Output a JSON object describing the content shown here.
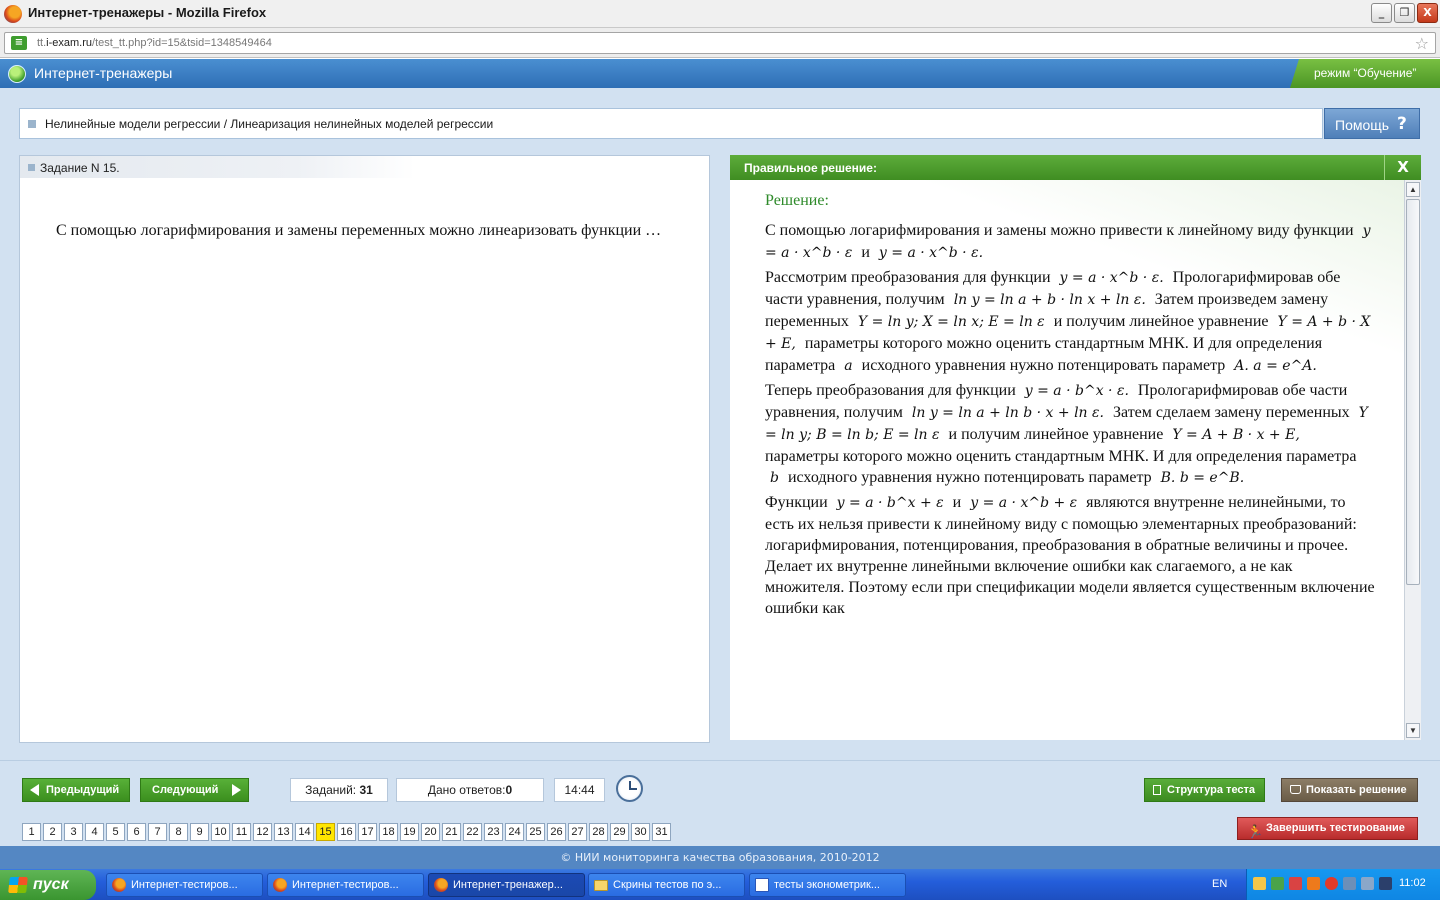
{
  "window": {
    "title": "Интернет-тренажеры - Mozilla Firefox",
    "url_prefix": "tt.",
    "url_host": "i-exam.ru",
    "url_path": "/test_tt.php?id=15&tsid=1348549464",
    "controls": {
      "minimize": "_",
      "maximize": "❐",
      "close": "X"
    }
  },
  "app": {
    "title": "Интернет-тренажеры",
    "mode": "режим “Обучение”"
  },
  "breadcrumb": {
    "text": "Нелинейные модели регрессии / Линеаризация нелинейных моделей регрессии"
  },
  "help": {
    "label": "Помощь",
    "icon": "?"
  },
  "task": {
    "header": "Задание N 15.",
    "question": "С помощью логарифмирования и замены переменных можно линеаризовать функции …"
  },
  "solution": {
    "header": "Правильное решение:",
    "close": "X",
    "heading": "Решение:",
    "text": {
      "p1": "С помощью логарифмирования и замены можно привести к линейному виду функции",
      "f1": "y = a · x^b · ε",
      "and": "и",
      "f2": "y = a · x^b · ε.",
      "p2a": "Рассмотрим преобразования для функции",
      "f3": "y = a · x^b · ε.",
      "p2b": "Прологарифмировав обе части уравнения, получим",
      "f4": "ln y = ln a + b · ln x + ln ε.",
      "p2c": "Затем произведем замену переменных",
      "f5": "Y = ln y; X = ln x; E = ln ε",
      "p2d": "и получим линейное уравнение",
      "f6": "Y = A + b · X + E,",
      "p2e": "параметры которого можно оценить стандартным МНК. И для определения параметра",
      "f7": "a",
      "p2f": "исходного уравнения нужно потенцировать параметр",
      "f8": "A.  a = e^A.",
      "p3a": "Теперь преобразования для функции",
      "f9": "y = a · b^x · ε.",
      "p3b": "Прологарифмировав обе части уравнения, получим",
      "f10": "ln y = ln a + ln b · x + ln ε.",
      "p3c": "Затем сделаем замену переменных",
      "f11": "Y = ln y; B = ln b; E = ln ε",
      "p3d": "и получим линейное уравнение",
      "f12": "Y = A + B · x + E,",
      "p3e": "параметры которого можно оценить стандартным МНК. И для определения параметра",
      "f13": "b",
      "p3f": "исходного уравнения нужно потенцировать параметр",
      "f14": "B.  b = e^B.",
      "p4a": "Функции",
      "f15": "y = a · b^x + ε",
      "f16": "y = a · x^b + ε",
      "p4b": "являются внутренне нелинейными, то есть их нельзя привести к линейному виду с помощью элементарных преобразований: логарифмирования, потенцирования, преобразования в обратные величины и прочее. Делает их внутренне линейными включение ошибки как слагаемого, а не как множителя. Поэтому если при спецификации модели является существенным включение ошибки как"
    }
  },
  "nav": {
    "prev": "Предыдущий",
    "next": "Следующий",
    "tasks_label": "Заданий:",
    "tasks_value": "31",
    "answers_label": "Дано ответов:",
    "answers_value": "0",
    "time": "14:44",
    "structure": "Структура теста",
    "show_solution": "Показать решение",
    "finish": "Завершить тестирование"
  },
  "pager": {
    "current": 15,
    "pages": [
      "1",
      "2",
      "3",
      "4",
      "5",
      "6",
      "7",
      "8",
      "9",
      "10",
      "11",
      "12",
      "13",
      "14",
      "15",
      "16",
      "17",
      "18",
      "19",
      "20",
      "21",
      "22",
      "23",
      "24",
      "25",
      "26",
      "27",
      "28",
      "29",
      "30",
      "31"
    ]
  },
  "footer": {
    "text": "© НИИ мониторинга качества образования, 2010-2012"
  },
  "taskbar": {
    "start": "пуск",
    "items": [
      {
        "label": "Интернет-тестиров...",
        "icon": "firefox-icon"
      },
      {
        "label": "Интернет-тестиров...",
        "icon": "firefox-icon"
      },
      {
        "label": "Интернет-тренажер...",
        "icon": "firefox-icon"
      },
      {
        "label": "Скрины тестов по э...",
        "icon": "folder-icon"
      },
      {
        "label": "тесты эконометрик...",
        "icon": "word-doc-icon"
      }
    ],
    "lang": "EN",
    "clock": "11:02"
  },
  "colors": {
    "app_blue": "#2e6eb5",
    "accent_green": "#3f8d22",
    "solution_heading": "#2e8a2a",
    "stage_bg": "#d2e1f1",
    "active_page": "#ffe600",
    "finish_red": "#b82c2c"
  }
}
